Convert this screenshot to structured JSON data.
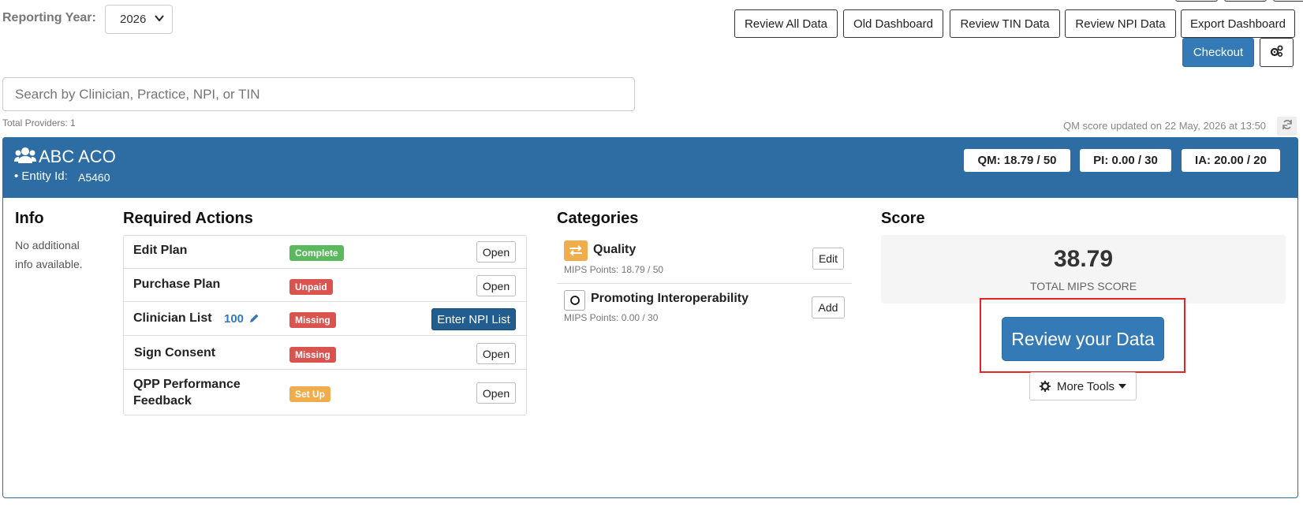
{
  "toolbar": {
    "reporting_year_label": "Reporting Year:",
    "reporting_year_value": "2026",
    "review_all_data": "Review All Data",
    "old_dashboard": "Old Dashboard",
    "review_tin_data": "Review TIN Data",
    "review_npi_data": "Review NPI Data",
    "export_dashboard": "Export Dashboard",
    "checkout": "Checkout",
    "settings_icon": "gears-icon"
  },
  "search": {
    "placeholder": "Search by Clinician, Practice, NPI, or TIN",
    "value": ""
  },
  "summary": {
    "total_providers": "Total Providers: 1",
    "qm_updated": "QM score updated on 22 May, 2026 at 13:50"
  },
  "entity": {
    "name": "ABC ACO",
    "entity_id_label": "• Entity Id:",
    "entity_id": "A5460",
    "qm_score": "QM: 18.79 / 50",
    "pi_score": "PI: 0.00 / 30",
    "ia_score": "IA: 20.00 / 20"
  },
  "info": {
    "title": "Info",
    "text": "No additional info available."
  },
  "required_actions": {
    "title": "Required Actions",
    "items": [
      {
        "name": "Edit Plan",
        "status": "Complete",
        "action": "Open"
      },
      {
        "name": "Purchase Plan",
        "status": "Unpaid",
        "action": "Open"
      },
      {
        "name": "Clinician List",
        "count": "100",
        "status": "Missing",
        "action": "Enter NPI List"
      },
      {
        "name": "Sign Consent",
        "status": "Missing",
        "action": "Open"
      },
      {
        "name": "QPP Performance Feedback",
        "status": "Set Up",
        "action": "Open"
      }
    ]
  },
  "categories": {
    "title": "Categories",
    "items": [
      {
        "name": "Quality",
        "points": "MIPS Points: 18.79 / 50",
        "action": "Edit"
      },
      {
        "name": "Promoting Interoperability",
        "points": "MIPS Points: 0.00 / 30",
        "action": "Add"
      }
    ]
  },
  "score": {
    "title": "Score",
    "value": "38.79",
    "label": "TOTAL MIPS SCORE",
    "review_button": "Review your Data",
    "more_tools": "More Tools"
  },
  "colors": {
    "header_blue": "#2e6da4",
    "primary": "#337ab7",
    "success": "#5cb85c",
    "danger": "#d9534f",
    "warning": "#f0ad4e",
    "highlight_red": "#e0242a"
  }
}
